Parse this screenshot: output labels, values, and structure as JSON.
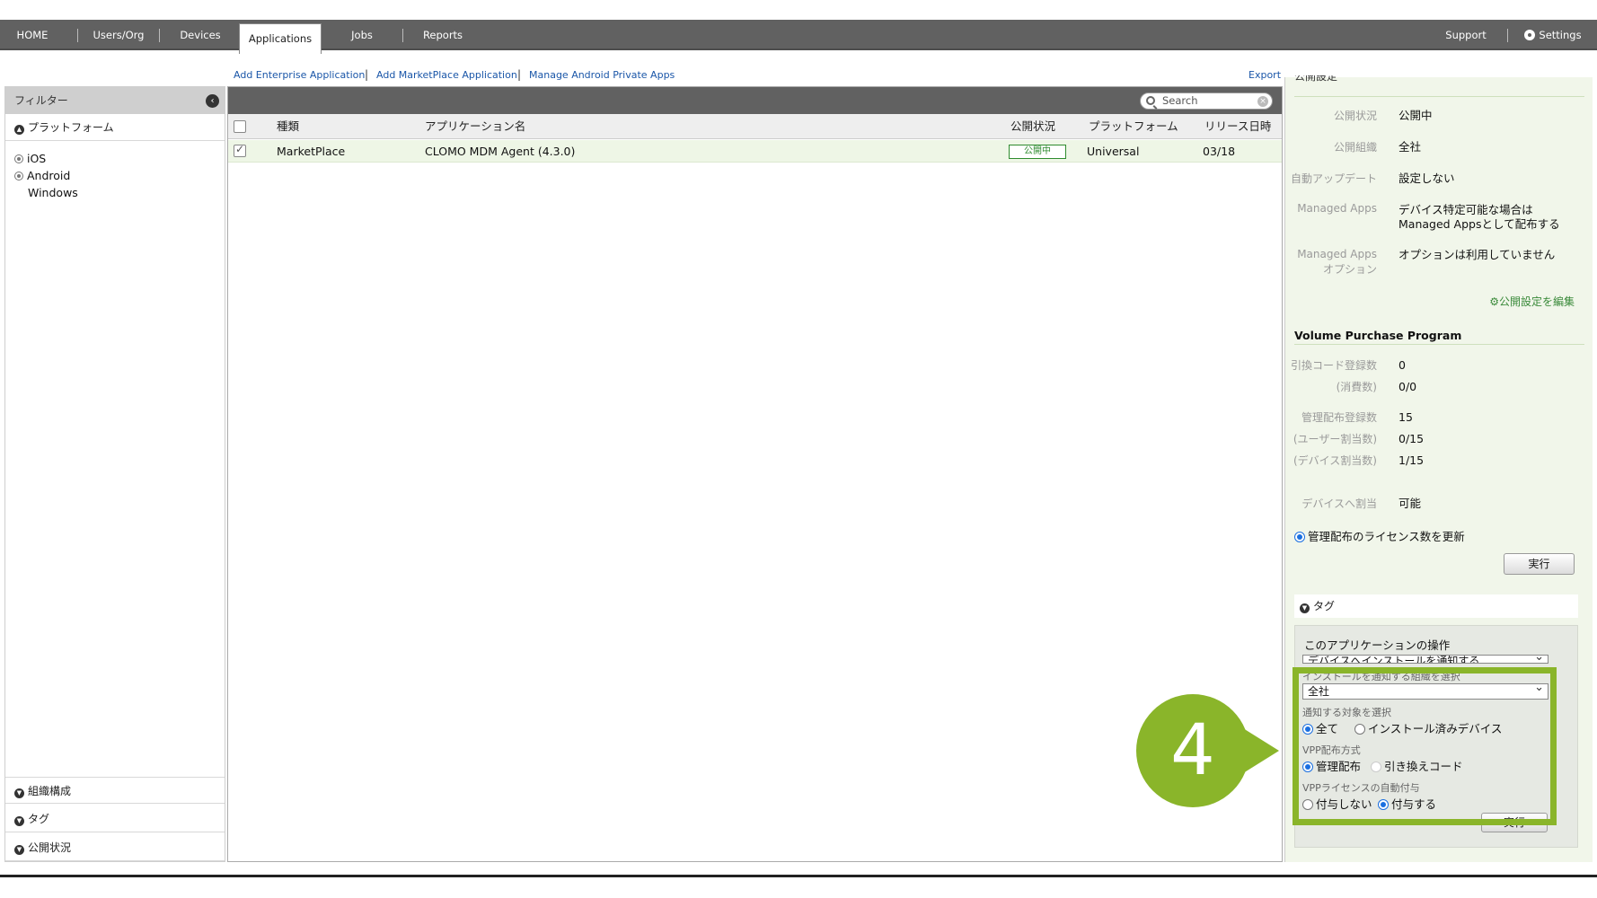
{
  "nav": {
    "items": [
      "HOME",
      "Users/Org",
      "Devices",
      "Applications",
      "Jobs",
      "Reports"
    ],
    "active": "Applications",
    "support": "Support",
    "settings": "Settings"
  },
  "actions": {
    "add_enterprise": "Add Enterprise Application",
    "add_marketplace": "Add MarketPlace Application",
    "manage_android": "Manage Android Private Apps",
    "export": "Export"
  },
  "sidebar": {
    "title": "フィルター",
    "platform_section": "プラットフォーム",
    "platforms": [
      "iOS",
      "Android",
      "Windows"
    ],
    "bottom_sections": [
      "組織構成",
      "タグ",
      "公開状況"
    ]
  },
  "search": {
    "placeholder": "Search"
  },
  "table": {
    "columns": [
      "種類",
      "アプリケーション名",
      "公開状況",
      "プラットフォーム",
      "リリース日時"
    ],
    "rows": [
      {
        "type": "MarketPlace",
        "name": "CLOMO MDM Agent (4.3.0)",
        "status": "公開中",
        "platform": "Universal",
        "release": "03/18"
      }
    ]
  },
  "detail": {
    "publish_header_partial": "公開設定",
    "publish": [
      {
        "label": "公開状況",
        "value": "公開中"
      },
      {
        "label": "公開組織",
        "value": "全社"
      },
      {
        "label": "自動アップデート",
        "value": "設定しない"
      },
      {
        "label": "Managed Apps",
        "value_line1": "デバイス特定可能な場合は",
        "value_line2": "Managed Appsとして配布する"
      },
      {
        "label_line1": "Managed Apps",
        "label_line2": "オプション",
        "value": "オプションは利用していません"
      }
    ],
    "edit_link": "公開設定を編集",
    "vpp_title": "Volume Purchase Program",
    "vpp": [
      {
        "label": "引換コード登録数",
        "value": "0"
      },
      {
        "label": "(消費数)",
        "value": "0/0"
      },
      {
        "label": "管理配布登録数",
        "value": "15"
      },
      {
        "label": "(ユーザー割当数)",
        "value": "0/15"
      },
      {
        "label": "(デバイス割当数)",
        "value": "1/15"
      },
      {
        "label": "デバイスへ割当",
        "value": "可能"
      }
    ],
    "update_license_label": "管理配布のライセンス数を更新",
    "execute_label": "実行",
    "tag_label": "タグ",
    "ops": {
      "title": "このアプリケーションの操作",
      "action_select": "デバイスへインストールを通知する",
      "org_label": "インストールを通知する組織を選択",
      "org_select": "全社",
      "target_label": "通知する対象を選択",
      "target_all": "全て",
      "target_installed": "インストール済みデバイス",
      "vpp_method_label": "VPP配布方式",
      "vpp_managed": "管理配布",
      "vpp_redeem": "引き換えコード",
      "auto_assign_label": "VPPライセンスの自動付与",
      "auto_no": "付与しない",
      "auto_yes": "付与する",
      "execute_label": "実行"
    }
  },
  "callout": {
    "number": "4"
  },
  "colors": {
    "accent_green": "#8ab52a",
    "nav_bg": "#616161",
    "link_blue": "#1a56a8"
  }
}
